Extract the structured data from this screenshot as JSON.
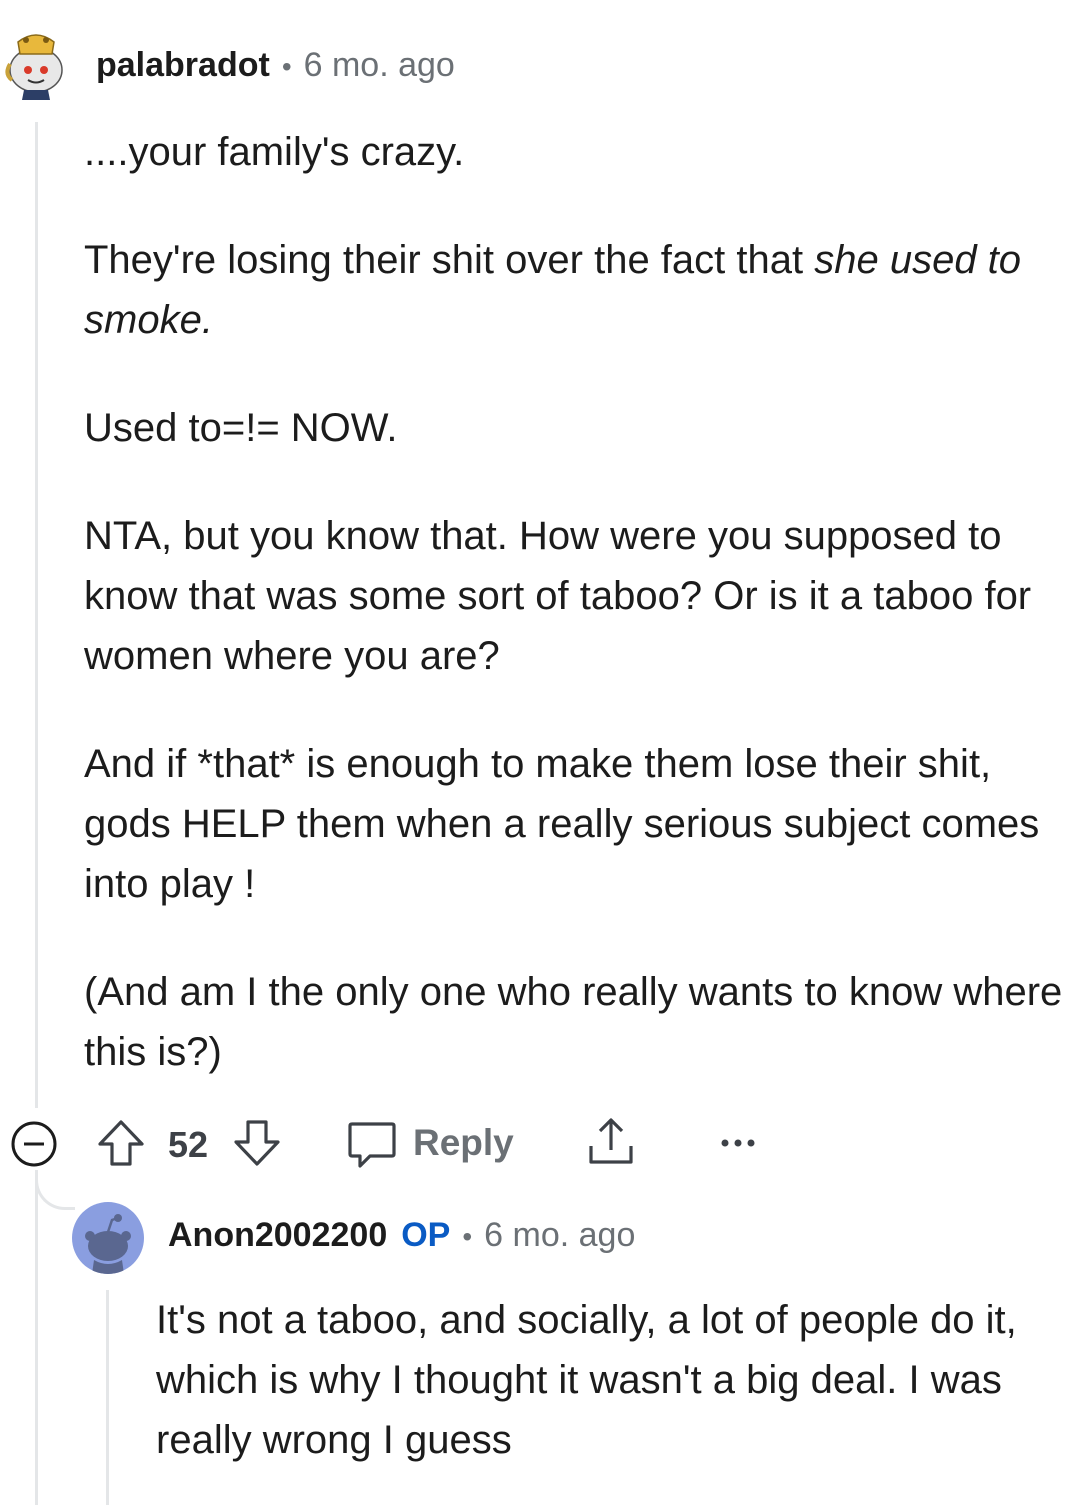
{
  "comment": {
    "author": "palabradot",
    "separator": "•",
    "time": "6 mo. ago",
    "avatar_icon": "snoo-avatar-crown-icon",
    "paragraphs": [
      "....your family's crazy.",
      "They're losing their shit over the fact that ",
      "Used to=!= NOW.",
      "NTA, but you know that. How were you supposed to know that was some sort of taboo? Or is it a taboo for women where you are?",
      "And if *that* is enough to make them lose their shit, gods HELP them when a really serious subject comes into play !",
      "(And am I the only one who really wants to know where this is?)"
    ],
    "emphasis": "she used to smoke.",
    "actions": {
      "collapse_icon": "collapse-minus-icon",
      "upvote_icon": "upvote-arrow-icon",
      "vote_count": "52",
      "downvote_icon": "downvote-arrow-icon",
      "reply_icon": "speech-bubble-icon",
      "reply_label": "Reply",
      "share_icon": "share-icon",
      "more_icon": "more-dots-icon"
    }
  },
  "reply": {
    "author": "Anon2002200",
    "op_badge": "OP",
    "separator": "•",
    "time": "6 mo. ago",
    "avatar_icon": "snoo-avatar-default-icon",
    "avatar_color": "#8a9ee0",
    "text": "It's not a taboo, and socially, a lot of people do it, which is why I thought it wasn't a big deal. I was really wrong I guess"
  },
  "colors": {
    "text": "#1c1c1c",
    "muted": "#6b7075",
    "op": "#0a5bc4",
    "thread_line": "#e4e6e8"
  }
}
